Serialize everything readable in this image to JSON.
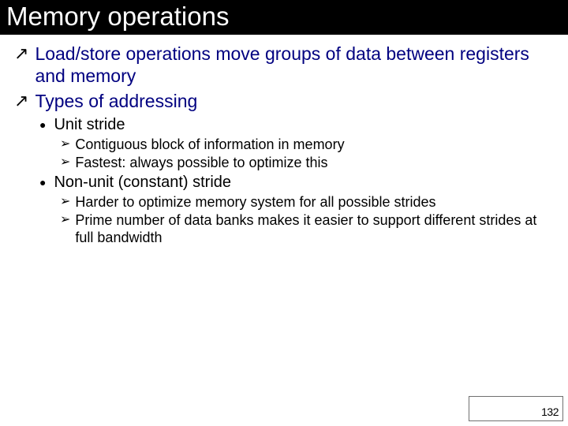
{
  "title": "Memory operations",
  "bullets": {
    "l1a": "Load/store operations move groups of data between registers and memory",
    "l1b": "Types of addressing",
    "l2a": "Unit stride",
    "l3a": "Contiguous block of information in memory",
    "l3b": "Fastest: always possible to optimize this",
    "l2b": "Non-unit (constant) stride",
    "l3c": "Harder to optimize memory system for all possible strides",
    "l3d": "Prime number of data banks makes it easier to support different strides at full bandwidth"
  },
  "page_number": "132",
  "glyphs": {
    "arrow": "↗",
    "dot": "●",
    "chevron": "➢"
  }
}
